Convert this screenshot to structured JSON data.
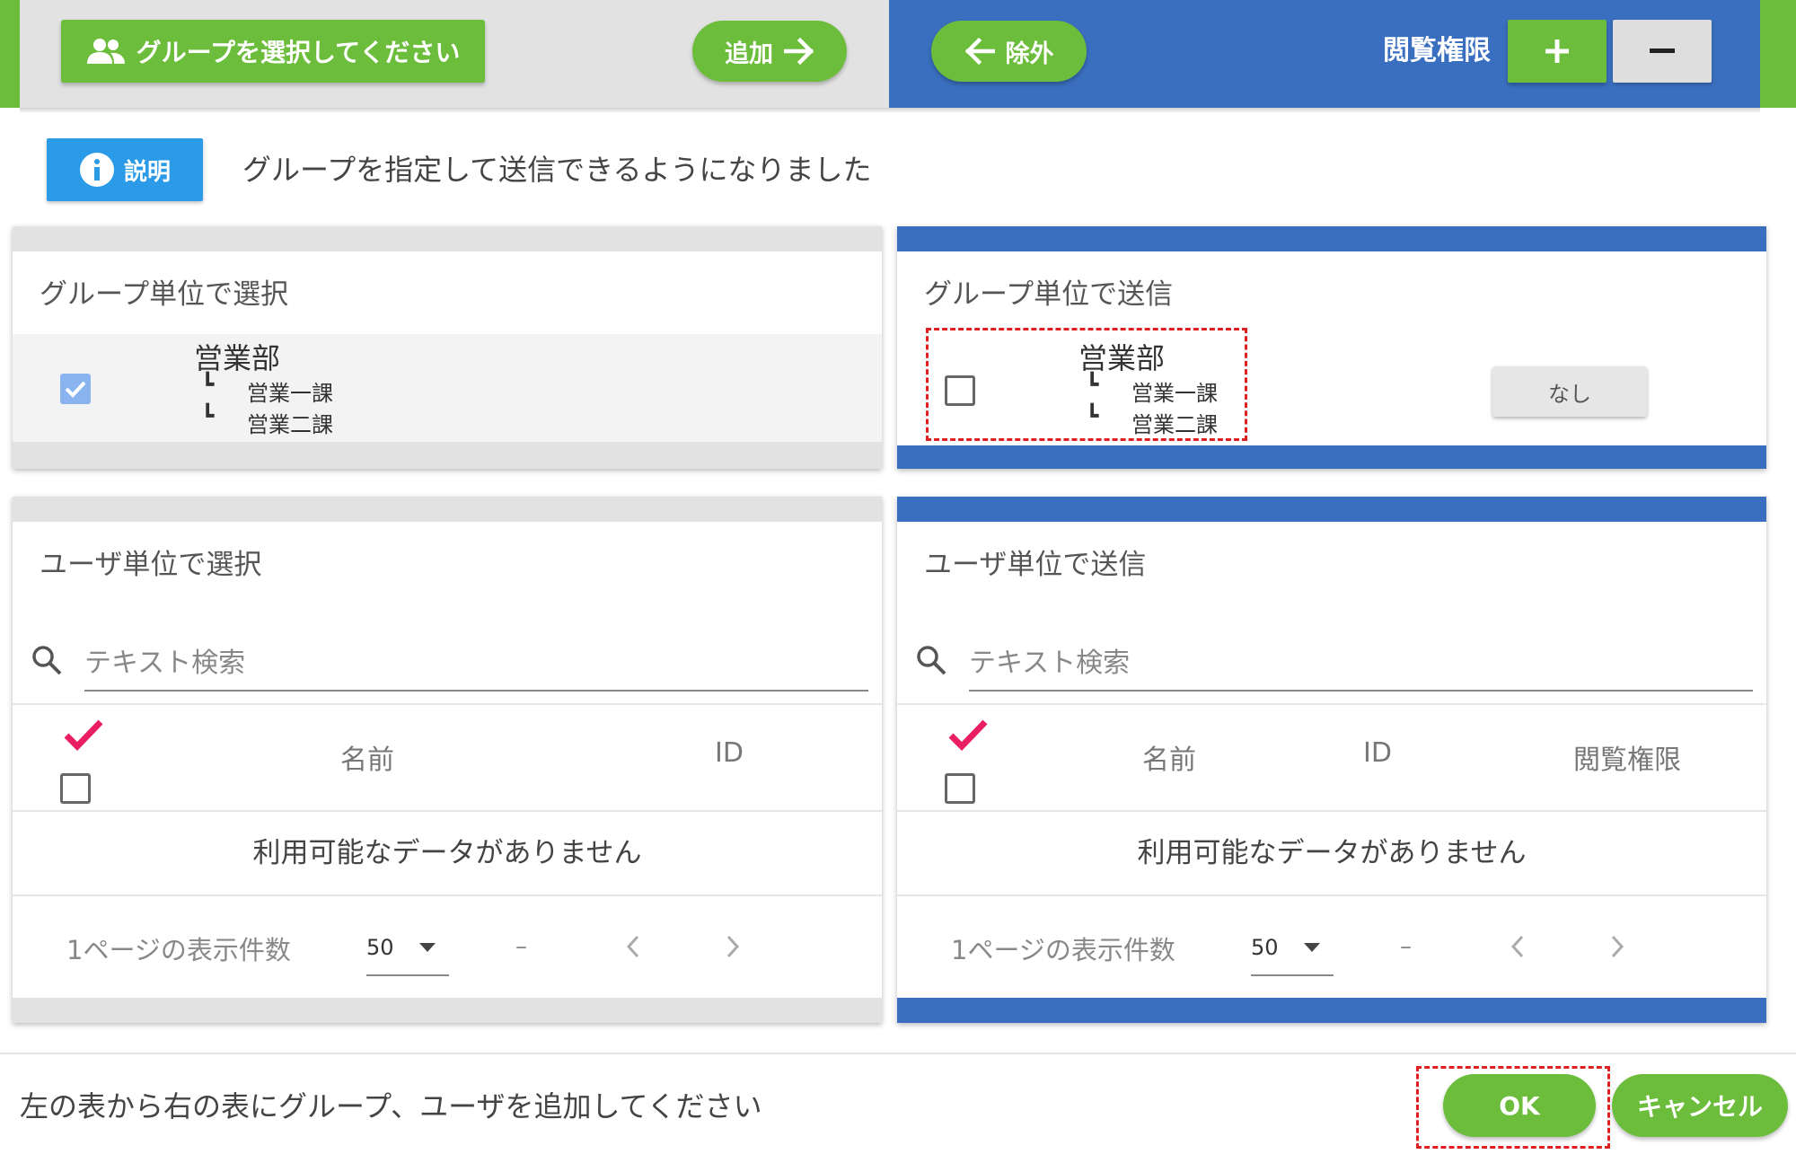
{
  "toolbar": {
    "select_group_label": "グループを選択してください",
    "add_label": "追加",
    "remove_label": "除外",
    "permission_label": "閲覧権限",
    "accent_green": "#6cbd3b",
    "accent_blue": "#3a6fbf",
    "icons": {
      "group": "group-icon",
      "add": "arrow-right-icon",
      "remove": "arrow-left-icon",
      "plus": "plus-icon",
      "minus": "minus-icon"
    }
  },
  "info": {
    "button_label": "説明",
    "message": "グループを指定して送信できるようになりました",
    "button_color": "#2b9be8"
  },
  "left_group_panel": {
    "title": "グループ単位で選択",
    "checked": true,
    "department": "営業部",
    "children": [
      "営業一課",
      "営業二課"
    ]
  },
  "right_group_panel": {
    "title": "グループ単位で送信",
    "checked": false,
    "department": "営業部",
    "children": [
      "営業一課",
      "営業二課"
    ],
    "permission_button": "なし"
  },
  "left_user_panel": {
    "title": "ユーザ単位で選択",
    "search_placeholder": "テキスト検索",
    "columns": [
      "名前",
      "ID"
    ],
    "empty_message": "利用可能なデータがありません",
    "rows_per_page_label": "1ページの表示件数",
    "rows_per_page": "50",
    "range_text": "–"
  },
  "right_user_panel": {
    "title": "ユーザ単位で送信",
    "search_placeholder": "テキスト検索",
    "columns": [
      "名前",
      "ID",
      "閲覧権限"
    ],
    "empty_message": "利用可能なデータがありません",
    "rows_per_page_label": "1ページの表示件数",
    "rows_per_page": "50",
    "range_text": "–"
  },
  "footer": {
    "instruction": "左の表から右の表にグループ、ユーザを追加してください",
    "ok_label": "OK",
    "cancel_label": "キャンセル"
  },
  "highlight_color": "#e02020",
  "check_color": "#e91e63"
}
